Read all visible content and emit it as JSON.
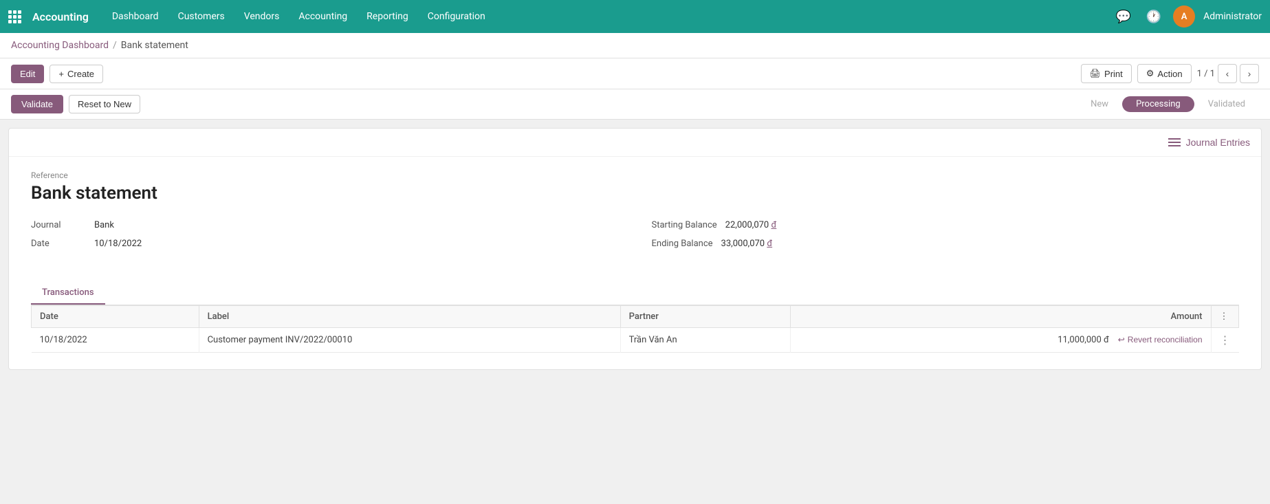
{
  "app": {
    "name": "Accounting",
    "apps_icon": "grid"
  },
  "topbar": {
    "nav_items": [
      {
        "label": "Dashboard",
        "id": "nav-dashboard"
      },
      {
        "label": "Customers",
        "id": "nav-customers"
      },
      {
        "label": "Vendors",
        "id": "nav-vendors"
      },
      {
        "label": "Accounting",
        "id": "nav-accounting"
      },
      {
        "label": "Reporting",
        "id": "nav-reporting"
      },
      {
        "label": "Configuration",
        "id": "nav-configuration"
      }
    ],
    "admin_avatar": "A",
    "admin_name": "Administrator"
  },
  "breadcrumb": {
    "parent_label": "Accounting Dashboard",
    "current_label": "Bank statement"
  },
  "toolbar": {
    "edit_label": "Edit",
    "create_label": "Create",
    "print_label": "Print",
    "action_label": "Action",
    "page_indicator": "1 / 1"
  },
  "status_bar": {
    "validate_label": "Validate",
    "reset_label": "Reset to New",
    "steps": [
      {
        "label": "New",
        "state": "inactive"
      },
      {
        "label": "Processing",
        "state": "active"
      },
      {
        "label": "Validated",
        "state": "inactive"
      }
    ]
  },
  "journal_entries": {
    "label": "Journal Entries"
  },
  "form": {
    "reference_label": "Reference",
    "title": "Bank statement",
    "fields": {
      "journal_label": "Journal",
      "journal_value": "Bank",
      "date_label": "Date",
      "date_value": "10/18/2022",
      "starting_balance_label": "Starting Balance",
      "starting_balance_value": "22,000,070",
      "starting_balance_currency": "đ",
      "ending_balance_label": "Ending Balance",
      "ending_balance_value": "33,000,070",
      "ending_balance_currency": "đ"
    }
  },
  "transactions_tab": {
    "label": "Transactions"
  },
  "table": {
    "columns": [
      {
        "label": "Date",
        "id": "col-date"
      },
      {
        "label": "Label",
        "id": "col-label"
      },
      {
        "label": "Partner",
        "id": "col-partner"
      },
      {
        "label": "Amount",
        "id": "col-amount"
      },
      {
        "label": "",
        "id": "col-actions"
      }
    ],
    "rows": [
      {
        "date": "10/18/2022",
        "label": "Customer payment INV/2022/00010",
        "partner": "Trần Văn An",
        "amount": "11,000,000",
        "currency": "đ",
        "action": "Revert reconciliation"
      }
    ]
  }
}
